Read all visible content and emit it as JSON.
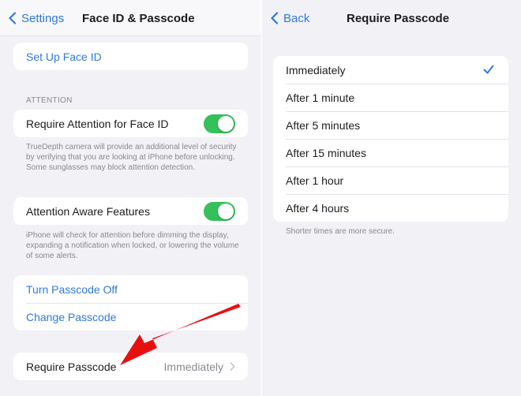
{
  "left_screen": {
    "nav": {
      "back_label": "Settings",
      "title": "Face ID & Passcode"
    },
    "setup_face_id": "Set Up Face ID",
    "attention_section": {
      "header": "ATTENTION",
      "require_attention": {
        "label": "Require Attention for Face ID",
        "enabled": true
      },
      "require_attention_footnote": "TrueDepth camera will provide an additional level of security by verifying that you are looking at iPhone before unlocking. Some sunglasses may block attention detection.",
      "attention_aware": {
        "label": "Attention Aware Features",
        "enabled": true
      },
      "attention_aware_footnote": "iPhone will check for attention before dimming the display, expanding a notification when locked, or lowering the volume of some alerts."
    },
    "passcode_actions": [
      "Turn Passcode Off",
      "Change Passcode"
    ],
    "require_passcode": {
      "label": "Require Passcode",
      "value": "Immediately"
    }
  },
  "right_screen": {
    "nav": {
      "back_label": "Back",
      "title": "Require Passcode"
    },
    "options": [
      {
        "label": "Immediately",
        "selected": true
      },
      {
        "label": "After 1 minute",
        "selected": false
      },
      {
        "label": "After 5 minutes",
        "selected": false
      },
      {
        "label": "After 15 minutes",
        "selected": false
      },
      {
        "label": "After 1 hour",
        "selected": false
      },
      {
        "label": "After 4 hours",
        "selected": false
      }
    ],
    "footnote": "Shorter times are more secure."
  },
  "annotation": {
    "type": "arrow",
    "color": "#e8100f",
    "points_to": "Require Passcode"
  },
  "colors": {
    "accent": "#2f7ad8",
    "toggle_on": "#34c05a",
    "background": "#f1f1f6"
  }
}
